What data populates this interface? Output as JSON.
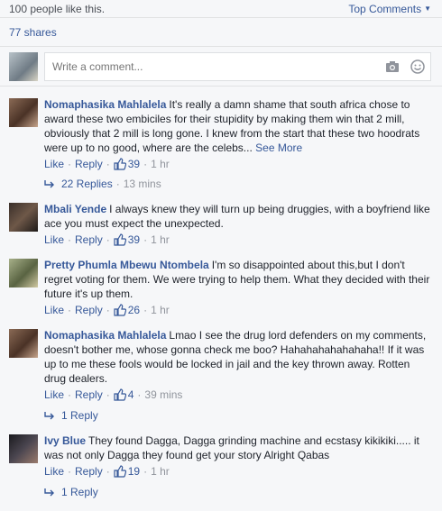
{
  "header": {
    "likes_text": "100 people like this.",
    "top_comments_label": "Top Comments"
  },
  "shares_text": "77 shares",
  "composer": {
    "placeholder": "Write a comment..."
  },
  "labels": {
    "like": "Like",
    "reply": "Reply",
    "sep": "·",
    "see_more": "See More"
  },
  "comments": [
    {
      "author": "Nomaphasika Mahlalela",
      "text": "It's really a damn shame that south africa chose to award these two embiciles for their stupidity by making them win that 2 mill, obviously that 2 mill is long gone. I knew from the start that these two hoodrats were up to no good, where are the celebs...",
      "likes": "39",
      "time": "1 hr",
      "replies": "22 Replies",
      "replies_time": "13 mins"
    },
    {
      "author": "Mbali Yende",
      "text": "I always knew they will turn up being druggies, with a boyfriend like ace you must expect the unexpected.",
      "likes": "39",
      "time": "1 hr"
    },
    {
      "author": "Pretty Phumla Mbewu Ntombela",
      "text": "I'm so disappointed about this,but I don't regret voting for them. We were trying to help them. What they decided with their future it's up them.",
      "likes": "26",
      "time": "1 hr"
    },
    {
      "author": "Nomaphasika Mahlalela",
      "text": "Lmao I see the drug lord defenders on my comments, doesn't bother me, whose gonna check me boo? Hahahahahahahaha!! If it was up to me these fools would be locked in jail and the key thrown away. Rotten drug dealers.",
      "likes": "4",
      "time": "39 mins",
      "replies": "1 Reply"
    },
    {
      "author": "Ivy Blue",
      "text": "They found Dagga, Dagga grinding machine and ecstasy kikikiki..... it was not only Dagga they found get your story Alright Qabas",
      "likes": "19",
      "time": "1 hr",
      "replies": "1 Reply"
    }
  ]
}
